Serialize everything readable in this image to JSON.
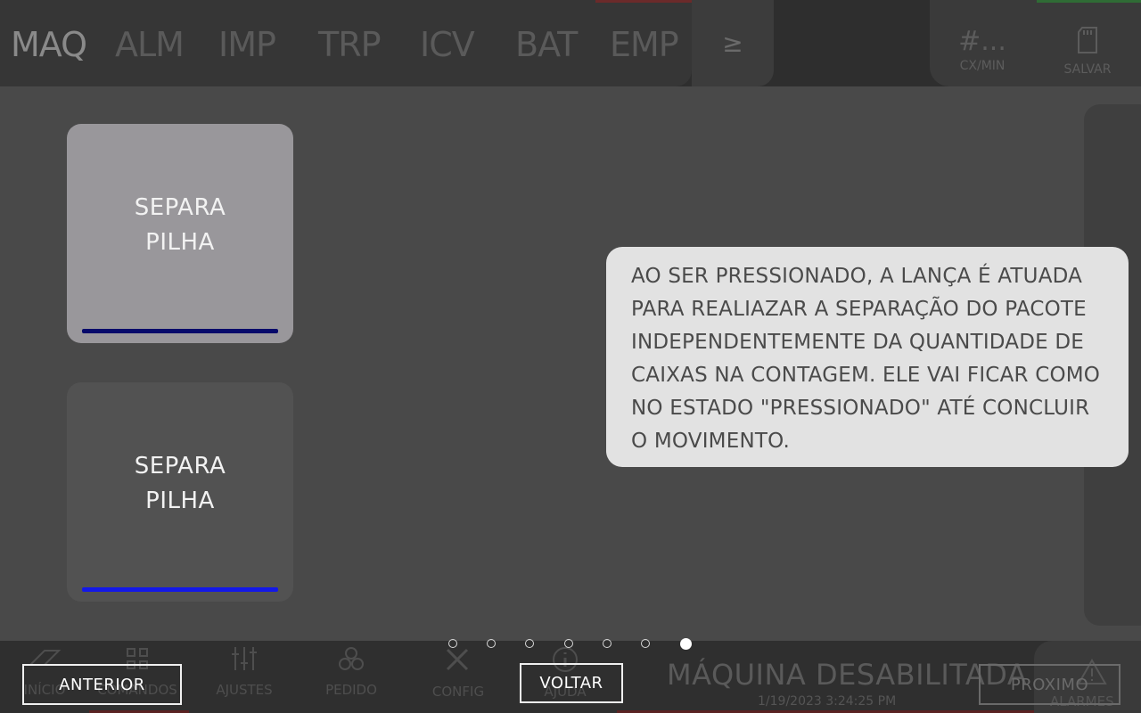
{
  "background": {
    "tabs": [
      "MAQ",
      "ALM",
      "IMP",
      "TRP",
      "ICV",
      "BAT",
      "EMP"
    ],
    "more_tab": "≥",
    "counter": {
      "value": "#...",
      "unit": "CX/MIN"
    },
    "save": {
      "icon": "sd-card-icon",
      "label": "SALVAR"
    },
    "nav": [
      {
        "label": "INÍCIO",
        "icon": "stripes-icon"
      },
      {
        "label": "COMANDOS",
        "icon": "grid-icon"
      },
      {
        "label": "AJUSTES",
        "icon": "sliders-icon"
      },
      {
        "label": "PEDIDO",
        "icon": "boxes-icon"
      },
      {
        "label": "CONFIG",
        "icon": "tools-icon"
      },
      {
        "label": "AJUDA",
        "icon": "info-icon"
      }
    ],
    "status": {
      "title": "MÁQUINA DESABILITADA",
      "datetime": "1/19/2023 3:24:25 PM"
    },
    "alarms": {
      "icon": "warning-icon",
      "label": "ALARMES"
    }
  },
  "tutorial": {
    "button_pressed": {
      "label": "SEPARA\nPILHA"
    },
    "button_normal": {
      "label": "SEPARA\nPILHA"
    },
    "tooltip": "AO SER PRESSIONADO, A LANÇA É ATUADA\nPARA REALIAZAR A SEPARAÇÃO DO PACOTE\nINDEPENDENTEMENTE DA QUANTIDADE DE\nCAIXAS NA CONTAGEM. ELE VAI FICAR COMO\nNO ESTADO \"PRESSIONADO\" ATÉ  CONCLUIR\nO MOVIMENTO.",
    "page_indicator": {
      "total": 7,
      "current": 7
    },
    "prev_label": "ANTERIOR",
    "back_label": "VOLTAR",
    "next_label": "PROXIMO"
  },
  "colors": {
    "pressed_indicator": "#060a6a",
    "normal_indicator": "#1318e8",
    "tooltip_bg": "#e2e2e2"
  }
}
